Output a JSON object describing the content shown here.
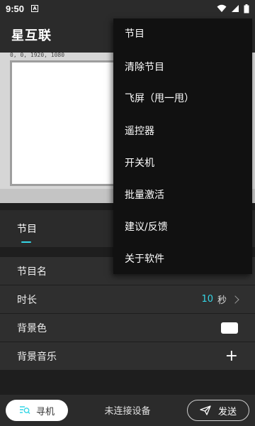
{
  "status_bar": {
    "time": "9:50",
    "a_icon": "A"
  },
  "app": {
    "title": "星互联"
  },
  "preview": {
    "coords": "0, 0, 1920, 1080"
  },
  "tabs": [
    {
      "label": "节目"
    }
  ],
  "rows": [
    {
      "label": "节目名"
    },
    {
      "label": "时长",
      "value": "10",
      "unit": "秒"
    },
    {
      "label": "背景色",
      "color": "#ffffff"
    },
    {
      "label": "背景音乐",
      "action": "+"
    }
  ],
  "bottom": {
    "seek_label": "寻机",
    "status": "未连接设备",
    "send_label": "发送"
  },
  "menu": {
    "items": [
      "节目",
      "清除节目",
      "飞屏（甩一甩）",
      "遥控器",
      "开关机",
      "批量激活",
      "建议/反馈",
      "关于软件"
    ]
  },
  "colors": {
    "accent": "#35d6e6",
    "surface": "#2f2f2f",
    "background": "#1e1e1e"
  },
  "icons": [
    "wifi-icon",
    "signal-icon",
    "battery-icon",
    "chevron-right-icon",
    "search-device-icon",
    "send-icon"
  ]
}
